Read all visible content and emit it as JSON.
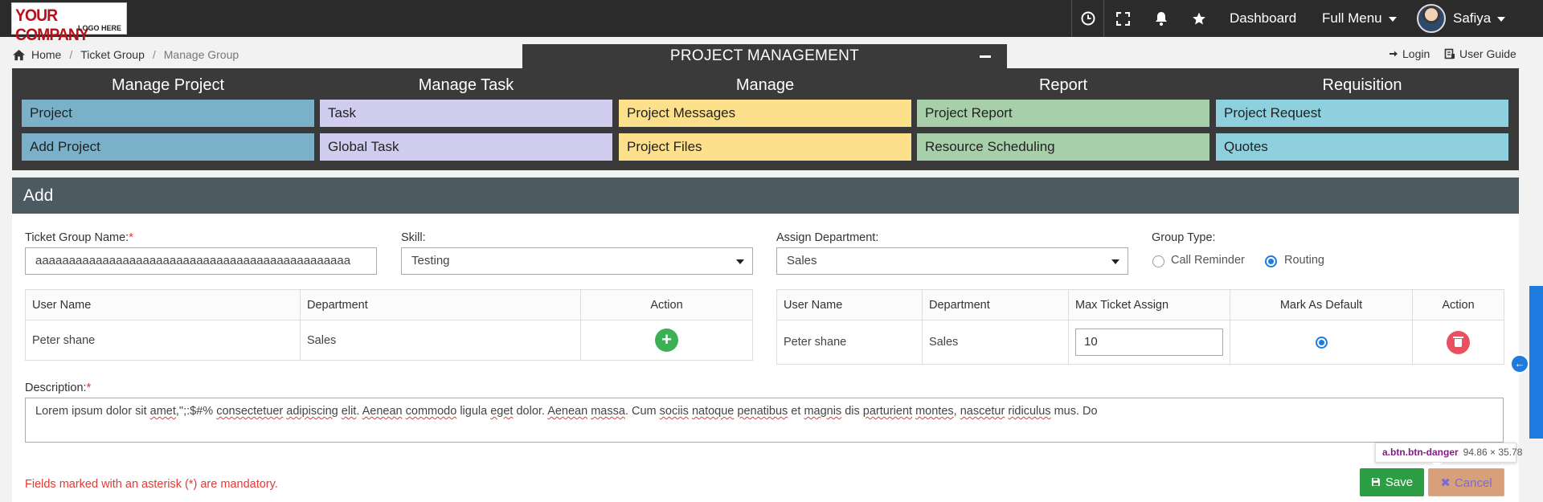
{
  "header": {
    "logo_line1": "YOUR COMPANY",
    "logo_line2": "LOGO HERE",
    "dashboard": "Dashboard",
    "full_menu": "Full Menu",
    "user_name": "Safiya",
    "icons": [
      "clock-icon",
      "fullscreen-icon",
      "bell-icon",
      "star-icon"
    ]
  },
  "breadcrumb": {
    "items": [
      "Home",
      "Ticket Group",
      "Manage Group"
    ],
    "login": "Login",
    "user_guide": "User Guide"
  },
  "pm_tab": {
    "title": "PROJECT MANAGEMENT"
  },
  "menu": {
    "columns": [
      {
        "title": "Manage Project",
        "color": "#7ab1c8",
        "items": [
          "Project",
          "Add Project"
        ]
      },
      {
        "title": "Manage Task",
        "color": "#d0cdee",
        "items": [
          "Task",
          "Global Task"
        ]
      },
      {
        "title": "Manage",
        "color": "#fde08c",
        "items": [
          "Project Messages",
          "Project Files"
        ]
      },
      {
        "title": "Report",
        "color": "#a7cfa9",
        "items": [
          "Project Report",
          "Resource Scheduling"
        ]
      },
      {
        "title": "Requisition",
        "color": "#8fd0df",
        "items": [
          "Project Request",
          "Quotes"
        ]
      }
    ]
  },
  "form": {
    "title": "Add",
    "ticket_group_label": "Ticket Group Name:",
    "ticket_group_value": "aaaaaaaaaaaaaaaaaaaaaaaaaaaaaaaaaaaaaaaaaaaaaaa",
    "skill_label": "Skill:",
    "skill_value": "Testing",
    "dept_label": "Assign Department:",
    "dept_value": "Sales",
    "group_type_label": "Group Type:",
    "group_type_options": [
      "Call Reminder",
      "Routing"
    ],
    "group_type_selected": "Routing",
    "left_table": {
      "headers": [
        "User Name",
        "Department",
        "Action"
      ],
      "rows": [
        {
          "user": "Peter shane",
          "dept": "Sales"
        }
      ]
    },
    "right_table": {
      "headers": [
        "User Name",
        "Department",
        "Max Ticket Assign",
        "Mark As Default",
        "Action"
      ],
      "rows": [
        {
          "user": "Peter shane",
          "dept": "Sales",
          "max": "10"
        }
      ]
    },
    "description_label": "Description:",
    "description_value": {
      "p1": "Lorem ipsum dolor sit ",
      "w1": "amet",
      "p2": ",\";:$#% ",
      "w2": "consectetuer",
      "p3": " ",
      "w3": "adipiscing",
      "p4": " ",
      "w4": "elit",
      "p5": ". ",
      "w5": "Aenean",
      "p6": " ",
      "w6": "commodo",
      "p7": " ligula ",
      "w7": "eget",
      "p8": " dolor. ",
      "w8": "Aenean",
      "p9": " ",
      "w9": "massa",
      "p10": ". Cum ",
      "w10": "sociis",
      "p11": " ",
      "w11": "natoque",
      "p12": " ",
      "w12": "penatibus",
      "p13": " et ",
      "w13": "magnis",
      "p14": " dis ",
      "w14": "parturient",
      "p15": " ",
      "w15": "montes",
      "p16": ", ",
      "w16": "nascetur",
      "p17": " ",
      "w17": "ridiculus",
      "p18": " mus. Do"
    },
    "mandatory_note": "Fields marked with an asterisk (*) are mandatory.",
    "save": "Save",
    "cancel": "Cancel"
  },
  "tooltip": {
    "selector": "a.btn.btn-danger",
    "size": "94.86 × 35.78"
  }
}
